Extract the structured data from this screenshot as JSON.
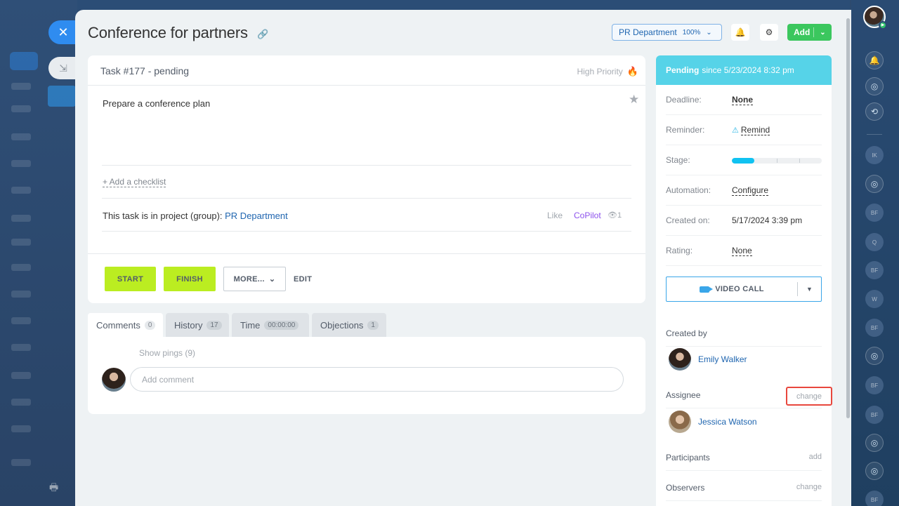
{
  "window": {
    "title": "Conference for partners",
    "close_icon": "close-icon",
    "minimize_icon": "collapse-icon"
  },
  "header": {
    "project_label": "PR Department",
    "project_percent": "100%",
    "add_label": "Add"
  },
  "task": {
    "title": "Task #177 - pending",
    "priority": "High Priority",
    "description": "Prepare a conference plan",
    "add_checklist": "+ Add a checklist",
    "project_prefix": "This task is in project (group):",
    "project_name": "PR Department",
    "like_label": "Like",
    "copilot_label": "CoPilot",
    "views": "1"
  },
  "actions": {
    "start": "START",
    "finish": "FINISH",
    "more": "MORE...",
    "edit": "EDIT"
  },
  "tabs": [
    {
      "label": "Comments",
      "count": "0"
    },
    {
      "label": "History",
      "count": "17"
    },
    {
      "label": "Time",
      "count": "00:00:00"
    },
    {
      "label": "Objections",
      "count": "1"
    }
  ],
  "comments": {
    "show_pings": "Show pings (9)",
    "placeholder": "Add comment"
  },
  "side": {
    "status_bold": "Pending",
    "status_rest": "since 5/23/2024 8:32 pm",
    "rows": [
      {
        "key": "Deadline:",
        "value": "None"
      },
      {
        "key": "Reminder:",
        "value": "Remind"
      },
      {
        "key": "Stage:",
        "value": ""
      },
      {
        "key": "Automation:",
        "value": "Configure"
      },
      {
        "key": "Created on:",
        "value": "5/17/2024 3:39 pm"
      },
      {
        "key": "Rating:",
        "value": "None"
      }
    ],
    "stage_progress": 0.25,
    "video_call": "VIDEO CALL",
    "created_by_label": "Created by",
    "created_by_name": "Emily Walker",
    "assignee_label": "Assignee",
    "assignee_change": "change",
    "assignee_name": "Jessica Watson",
    "participants_label": "Participants",
    "participants_add": "add",
    "observers_label": "Observers",
    "observers_change": "change"
  },
  "right_sidebar": {
    "avatars": [
      "IK",
      "BF",
      "Q",
      "BF",
      "W",
      "BF",
      "BF",
      "BF",
      "BF"
    ]
  }
}
